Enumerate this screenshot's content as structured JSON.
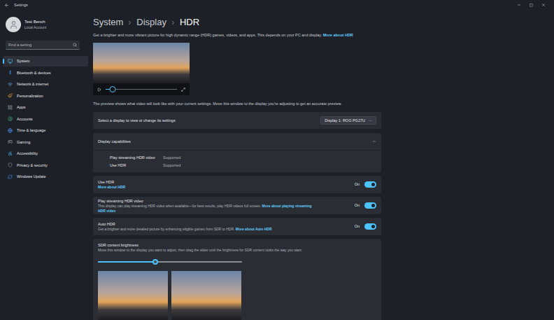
{
  "window": {
    "title": "Settings"
  },
  "account": {
    "name": "Test Bench",
    "type": "Local Account"
  },
  "search": {
    "placeholder": "Find a setting"
  },
  "sidebar": {
    "items": [
      {
        "label": "System",
        "selected": true,
        "color": "#4cc2ff"
      },
      {
        "label": "Bluetooth & devices",
        "selected": false,
        "color": "#3b8eea"
      },
      {
        "label": "Network & internet",
        "selected": false,
        "color": "#6aa7e8"
      },
      {
        "label": "Personalization",
        "selected": false,
        "color": "#e8a33d"
      },
      {
        "label": "Apps",
        "selected": false,
        "color": "#9aa3ad"
      },
      {
        "label": "Accounts",
        "selected": false,
        "color": "#3fb27f"
      },
      {
        "label": "Time & language",
        "selected": false,
        "color": "#4c9aff"
      },
      {
        "label": "Gaming",
        "selected": false,
        "color": "#a7adb5"
      },
      {
        "label": "Accessibility",
        "selected": false,
        "color": "#4cc2ff"
      },
      {
        "label": "Privacy & security",
        "selected": false,
        "color": "#9aa3ad"
      },
      {
        "label": "Windows Update",
        "selected": false,
        "color": "#3b8eea"
      }
    ]
  },
  "breadcrumb": [
    "System",
    "Display",
    "HDR"
  ],
  "description": {
    "text": "Get a brighter and more vibrant picture for high dynamic range (HDR) games, videos, and apps. This depends on your PC and display.",
    "link": "More about HDR"
  },
  "preview": {
    "level": 0.1,
    "note": "The preview shows what video will look like with your current settings. Move this window to the display you're adjusting to get an accurate preview."
  },
  "display_select": {
    "label": "Select a display to view or change its settings",
    "value": "Display 1: ROG PG27U"
  },
  "capabilities": {
    "title": "Display capabilities",
    "expanded": true,
    "rows": [
      {
        "label": "Play streaming HDR video",
        "value": "Supported"
      },
      {
        "label": "Use HDR",
        "value": "Supported"
      }
    ]
  },
  "toggles": [
    {
      "title": "Use HDR",
      "link": "More about HDR",
      "on": true,
      "state": "On"
    },
    {
      "title": "Play streaming HDR video",
      "description": "This display can play streaming HDR video when available—for best results, play HDR videos full screen.",
      "link": "More about playing streaming HDR video",
      "on": true,
      "state": "On"
    },
    {
      "title": "Auto HDR",
      "description": "Get a brighter and more detailed picture by enhancing eligible games from SDR to HDR.",
      "link": "More about Auto HDR",
      "on": true,
      "state": "On"
    }
  ],
  "sdr": {
    "title": "SDR content brightness",
    "description": "Move this window to the display you want to adjust, then drag the slider until the brightness for SDR content looks the way you want",
    "level": 0.4
  }
}
